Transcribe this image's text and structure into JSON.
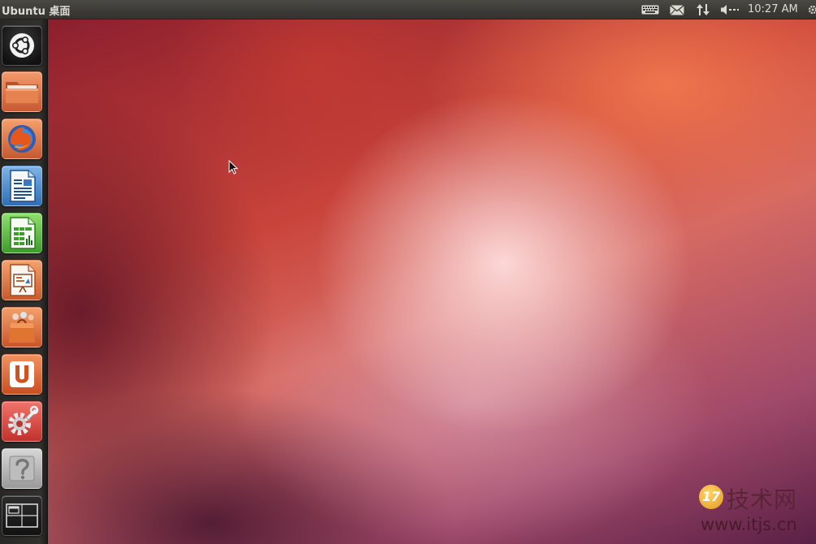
{
  "top_panel": {
    "title": "Ubuntu 桌面",
    "clock": "10:27 AM",
    "tray_icons": [
      "keyboard-icon",
      "mail-icon",
      "network-icon",
      "sound-icon",
      "gear-icon"
    ]
  },
  "launcher": {
    "items": [
      {
        "name": "dash-home",
        "icon": "ubuntu-logo-icon"
      },
      {
        "name": "home-folder",
        "icon": "folder-icon"
      },
      {
        "name": "firefox",
        "icon": "firefox-icon"
      },
      {
        "name": "libreoffice-writer",
        "icon": "writer-document-icon"
      },
      {
        "name": "libreoffice-calc",
        "icon": "calc-spreadsheet-icon"
      },
      {
        "name": "libreoffice-impress",
        "icon": "impress-presentation-icon"
      },
      {
        "name": "ubuntu-software-center",
        "icon": "shopping-bag-icon"
      },
      {
        "name": "ubuntu-one",
        "icon": "ubuntu-one-icon"
      },
      {
        "name": "system-settings",
        "icon": "settings-wrench-icon"
      },
      {
        "name": "help",
        "icon": "question-mark-icon"
      },
      {
        "name": "workspace-switcher",
        "icon": "workspaces-icon"
      }
    ]
  },
  "watermark": {
    "badge": "17",
    "name": "技术网",
    "url": "www.itjs.cn"
  },
  "colors": {
    "panel": "#3c3b37",
    "launcher": "#2f2d2a",
    "wallpaper_accent": "#c8433a"
  }
}
